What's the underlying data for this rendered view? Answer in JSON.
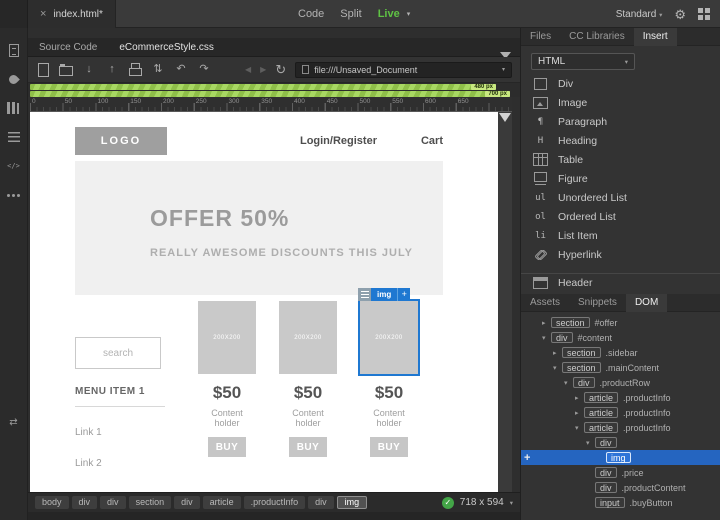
{
  "titlebar": {
    "tab_close": "×",
    "tab_title": "index.html*",
    "code": "Code",
    "split": "Split",
    "live": "Live",
    "live_chevron": "▾",
    "workspace": "Standard",
    "workspace_chevron": "▾",
    "gear": "⚙"
  },
  "leftbar": {
    "icons": [
      {
        "name": "files-icon",
        "wrap": "lb-item",
        "cls": "lb-ic ic-file"
      },
      {
        "name": "ink-styles-icon",
        "wrap": "lb-item",
        "cls": "lb-ic ic-ink"
      },
      {
        "name": "library-icon",
        "wrap": "lb-item",
        "cls": "lb-ic ic-lib"
      },
      {
        "name": "list-icon",
        "wrap": "lb-item",
        "cls": "lb-ic ic-list"
      },
      {
        "name": "snippets-icon",
        "wrap": "lb-item",
        "cls": "lb-ic ic-snip"
      },
      {
        "name": "more-tools-icon",
        "wrap": "lb-item",
        "cls": "lb-ic ic-more"
      },
      {
        "name": "swap-views-icon",
        "wrap": "lb-item lb-low",
        "cls": "lb-ic ic-swap"
      }
    ]
  },
  "related_files": {
    "source_code": "Source Code",
    "stylesheet": "eCommerceStyle.css"
  },
  "toolbar": {
    "icons": [
      {
        "name": "new-file-icon",
        "cls": "tb-ic ic-newfile",
        "glyph": ""
      },
      {
        "name": "open-file-icon",
        "cls": "tb-ic ic-open",
        "glyph": ""
      },
      {
        "name": "get-file-icon",
        "cls": "tb-ic",
        "glyph": "↓"
      },
      {
        "name": "put-file-icon",
        "cls": "tb-ic",
        "glyph": "↑"
      },
      {
        "name": "print-icon",
        "cls": "tb-ic ic-print",
        "glyph": ""
      },
      {
        "name": "sync-icon",
        "cls": "tb-ic",
        "glyph": "⇅"
      },
      {
        "name": "undo-icon",
        "cls": "tb-ic",
        "glyph": "↶"
      },
      {
        "name": "redo-icon",
        "cls": "tb-ic",
        "glyph": "↷"
      }
    ],
    "back": "◀",
    "forward": "▶",
    "refresh": "↻",
    "address": "file:///Unsaved_Document",
    "address_chevron": "▾"
  },
  "mq": {
    "bar1_label": "480 px",
    "bar2_label": "700 px"
  },
  "ruler": {
    "labels": [
      0,
      50,
      100,
      150,
      200,
      250,
      300,
      350,
      400,
      450,
      500,
      550,
      600,
      650
    ]
  },
  "canvas": {
    "header": {
      "logo": "LOGO",
      "login": "Login/Register",
      "cart": "Cart"
    },
    "offer": {
      "title": "OFFER 50%",
      "subtitle": "REALLY AWESOME DISCOUNTS THIS JULY"
    },
    "sidebar": {
      "search_placeholder": "search",
      "menu_title": "MENU ITEM 1",
      "links": [
        {
          "label": "Link 1"
        },
        {
          "label": "Link 2"
        }
      ]
    },
    "products": [
      {
        "img_label": "200X200",
        "price": "$50",
        "content": "Content holder",
        "buy": "BUY",
        "selected": false
      },
      {
        "img_label": "200X200",
        "price": "$50",
        "content": "Content holder",
        "buy": "BUY",
        "selected": false
      },
      {
        "img_label": "200X200",
        "price": "$50",
        "content": "Content holder",
        "buy": "BUY",
        "selected": true
      }
    ],
    "hud": {
      "tag": "img",
      "add": "+"
    }
  },
  "statusbar": {
    "tags": [
      {
        "label": "body"
      },
      {
        "label": "div"
      },
      {
        "label": "div"
      },
      {
        "label": "section"
      },
      {
        "label": "div"
      },
      {
        "label": "article"
      },
      {
        "label": ".productInfo"
      },
      {
        "label": "div"
      },
      {
        "label": "img",
        "current": true
      }
    ],
    "check": "✓",
    "dimensions": "718 x 594",
    "chevron": "▾"
  },
  "insert_panel": {
    "tabs": [
      {
        "id": "tab-files",
        "label": "Files",
        "active": false
      },
      {
        "id": "tab-cc-libraries",
        "label": "CC Libraries",
        "active": false
      },
      {
        "id": "tab-insert",
        "label": "Insert",
        "active": true
      }
    ],
    "category": "HTML",
    "category_chevron": "▾",
    "items": [
      {
        "id": "insert-item-div",
        "icon": "div-icon",
        "cls": "ins-ic ic-divbox",
        "glyph": "",
        "label": "Div",
        "divider": false
      },
      {
        "id": "insert-item-image",
        "icon": "image-icon",
        "cls": "ins-ic ic-img",
        "glyph": "",
        "label": "Image",
        "divider": false
      },
      {
        "id": "insert-item-paragraph",
        "icon": "paragraph-icon",
        "cls": "ins-ic",
        "glyph": "¶",
        "label": "Paragraph",
        "divider": false
      },
      {
        "id": "insert-item-heading",
        "icon": "heading-icon",
        "cls": "ins-ic",
        "glyph": "H",
        "label": "Heading",
        "divider": false
      },
      {
        "id": "insert-item-table",
        "icon": "table-icon",
        "cls": "ins-ic ic-table",
        "glyph": "",
        "label": "Table",
        "divider": false
      },
      {
        "id": "insert-item-figure",
        "icon": "figure-icon",
        "cls": "ins-ic ic-figure",
        "glyph": "",
        "label": "Figure",
        "divider": false
      },
      {
        "id": "insert-item-unordered-list",
        "icon": "unordered-list-icon",
        "cls": "ins-ic",
        "glyph": "ul",
        "label": "Unordered List",
        "divider": false
      },
      {
        "id": "insert-item-ordered-list",
        "icon": "ordered-list-icon",
        "cls": "ins-ic",
        "glyph": "ol",
        "label": "Ordered List",
        "divider": false
      },
      {
        "id": "insert-item-list-item",
        "icon": "list-item-icon",
        "cls": "ins-ic",
        "glyph": "li",
        "label": "List Item",
        "divider": false
      },
      {
        "id": "insert-item-hyperlink",
        "icon": "hyperlink-icon",
        "cls": "ins-ic ic-link",
        "glyph": "",
        "label": "Hyperlink",
        "divider": false
      },
      {
        "id": "insert-item-header",
        "icon": "header-icon",
        "cls": "ins-ic ic-header",
        "glyph": "",
        "label": "Header",
        "divider": true
      }
    ]
  },
  "dom_panel": {
    "tabs": [
      {
        "id": "tab-assets",
        "label": "Assets",
        "active": false
      },
      {
        "id": "tab-snippets",
        "label": "Snippets",
        "active": false
      },
      {
        "id": "tab-dom",
        "label": "DOM",
        "active": true
      }
    ],
    "add": "+",
    "rows": [
      {
        "indent": 1,
        "arrow": "▸",
        "tag": "section",
        "suffix": "#offer",
        "selected": false
      },
      {
        "indent": 1,
        "arrow": "▾",
        "tag": "div",
        "suffix": "#content",
        "selected": false
      },
      {
        "indent": 2,
        "arrow": "▸",
        "tag": "section",
        "suffix": ".sidebar",
        "selected": false
      },
      {
        "indent": 2,
        "arrow": "▾",
        "tag": "section",
        "suffix": ".mainContent",
        "selected": false
      },
      {
        "indent": 3,
        "arrow": "▾",
        "tag": "div",
        "suffix": ".productRow",
        "selected": false
      },
      {
        "indent": 4,
        "arrow": "▸",
        "tag": "article",
        "suffix": ".productInfo",
        "selected": false
      },
      {
        "indent": 4,
        "arrow": "▸",
        "tag": "article",
        "suffix": ".productInfo",
        "selected": false
      },
      {
        "indent": 4,
        "arrow": "▾",
        "tag": "article",
        "suffix": ".productInfo",
        "selected": false
      },
      {
        "indent": 5,
        "arrow": "▾",
        "tag": "div",
        "suffix": "",
        "selected": false
      },
      {
        "indent": 6,
        "arrow": "",
        "tag": "img",
        "suffix": "",
        "selected": true
      },
      {
        "indent": 5,
        "arrow": "",
        "tag": "div",
        "suffix": ".price",
        "selected": false
      },
      {
        "indent": 5,
        "arrow": "",
        "tag": "div",
        "suffix": ".productContent",
        "selected": false
      },
      {
        "indent": 5,
        "arrow": "",
        "tag": "input",
        "suffix": ".buyButton",
        "selected": false
      }
    ]
  }
}
